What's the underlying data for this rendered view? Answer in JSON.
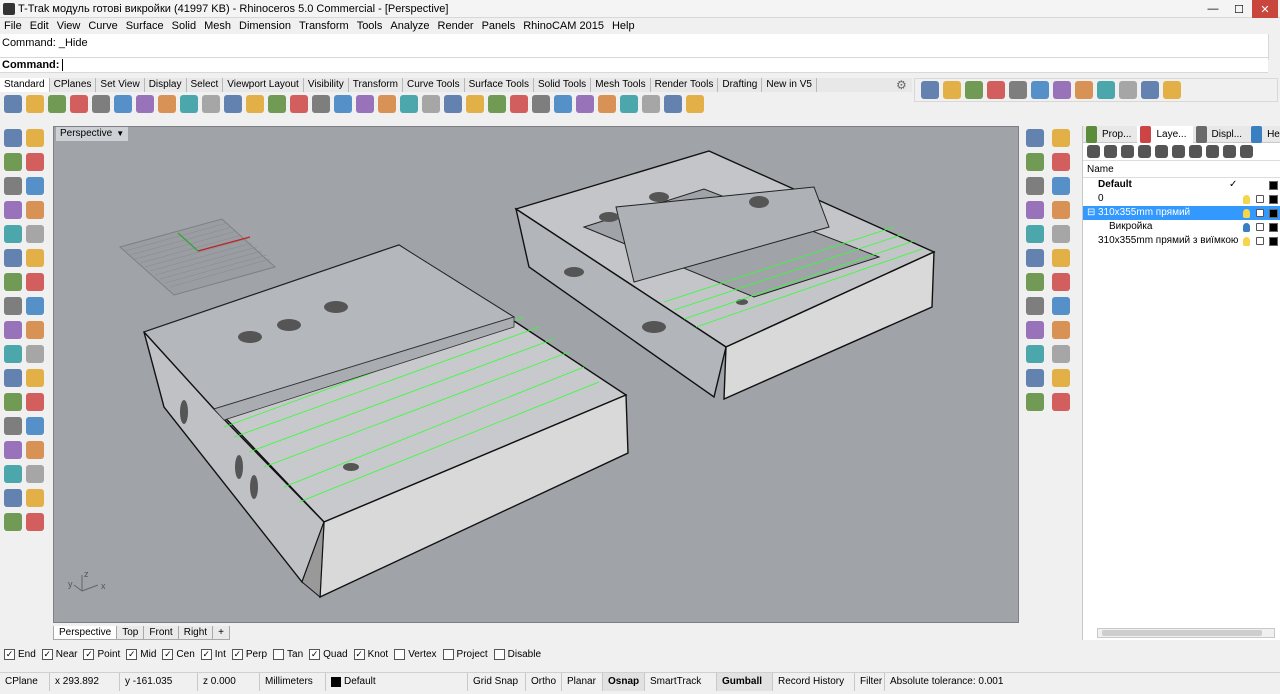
{
  "window": {
    "title": "T-Trak модуль готові викройки (41997 KB) - Rhinoceros 5.0 Commercial - [Perspective]",
    "minimize": "—",
    "maximize": "☐",
    "close": "✕"
  },
  "menu": [
    "File",
    "Edit",
    "View",
    "Curve",
    "Surface",
    "Solid",
    "Mesh",
    "Dimension",
    "Transform",
    "Tools",
    "Analyze",
    "Render",
    "Panels",
    "RhinoCAM 2015",
    "Help"
  ],
  "command": {
    "history": "Command: _Hide",
    "prompt": "Command:"
  },
  "toolbar_tabs": [
    "Standard",
    "CPlanes",
    "Set View",
    "Display",
    "Select",
    "Viewport Layout",
    "Visibility",
    "Transform",
    "Curve Tools",
    "Surface Tools",
    "Solid Tools",
    "Mesh Tools",
    "Render Tools",
    "Drafting",
    "New in V5"
  ],
  "toolbar_icons": [
    "new-icon",
    "open-icon",
    "save-icon",
    "print-icon",
    "import-icon",
    "cut-icon",
    "copy-icon",
    "paste-icon",
    "undo-icon",
    "hand-pan-icon",
    "rotate-view-icon",
    "zoom-icon",
    "zoom-window-icon",
    "zoom-extents-icon",
    "zoom-selected-icon",
    "viewport-4-icon",
    "grid-icon",
    "car-icon",
    "move-icon",
    "properties-icon",
    "light-bulb-icon",
    "layer-icon",
    "render-color-icon",
    "color-wheel-icon",
    "wire-sphere-icon",
    "shaded-sphere-icon",
    "render-sphere-icon",
    "ghost-sphere-icon",
    "blue-sphere-icon",
    "pencil-icon",
    "options-icon",
    "help-icon"
  ],
  "right_toolbar_icons": [
    "points-icon",
    "control-points-icon",
    "edit-points-icon",
    "drag-handle-icon",
    "box-icon",
    "rotate-icon",
    "gumball-icon",
    "move-icon",
    "mirror-icon",
    "cage-icon",
    "scale-icon",
    "more-icon"
  ],
  "left_tool_icons": [
    "select-arrow-icon",
    "point-icon",
    "polyline-icon",
    "rectangle-icon",
    "circle-icon",
    "ellipse-icon",
    "arc-icon",
    "polygon-icon",
    "curve-icon",
    "free-curve-icon",
    "surface-icon",
    "extrude-icon",
    "box-icon",
    "sphere-icon",
    "cylinder-icon",
    "loft-icon",
    "boolean-icon",
    "explode-icon",
    "fillet-icon",
    "chamfer-icon",
    "offset-icon",
    "trim-icon",
    "split-icon",
    "join-icon",
    "dimension-icon",
    "text-icon",
    "gumball-icon",
    "array-icon",
    "grid-array-icon",
    "mirror-icon",
    "check-icon",
    "mesh-icon",
    "analyze-icon",
    "render-icon"
  ],
  "mid_tool_icons": [
    "properties-icon",
    "flame-icon",
    "surface-blue-icon",
    "plane-icon",
    "cube-blue-icon",
    "cube-icon",
    "surface-edit-icon",
    "edge-icon",
    "shell-icon",
    "network-icon",
    "rebuild-icon",
    "paint-icon",
    "boolean-blue-icon",
    "sphere-blue-icon",
    "match-icon",
    "blend-icon",
    "unroll-icon",
    "cap-icon",
    "ruler-icon",
    "dimension-red-icon",
    "grip-icon",
    "clipping-plane-icon",
    "section-icon",
    "camera-icon"
  ],
  "viewport": {
    "label": "Perspective",
    "axis_x": "x",
    "axis_y": "y",
    "axis_z": "z"
  },
  "viewport_tabs": [
    "Perspective",
    "Top",
    "Front",
    "Right",
    "+"
  ],
  "panel": {
    "tabs": [
      {
        "label": "Prop...",
        "icon": "color-wheel-icon"
      },
      {
        "label": "Laye...",
        "icon": "layer-icon"
      },
      {
        "label": "Displ...",
        "icon": "display-icon"
      },
      {
        "label": "Help",
        "icon": "help-icon"
      }
    ],
    "tool_icons": [
      "new-layer-icon",
      "new-sublayer-icon",
      "delete-icon",
      "move-up-icon",
      "move-down-icon",
      "move-to-parent-icon",
      "filter-icon",
      "select-objects-icon",
      "layer-tools-icon",
      "layer-help-icon"
    ],
    "header": "Name",
    "layers": [
      {
        "name": "Default",
        "bold": true,
        "current": true,
        "check": "✓",
        "selected": false,
        "indent": 1
      },
      {
        "name": "0",
        "bold": false,
        "current": false,
        "check": "",
        "selected": false,
        "indent": 1
      },
      {
        "name": "310x355mm прямий",
        "bold": false,
        "current": false,
        "check": "",
        "selected": true,
        "indent": 1,
        "toggle": "⊟"
      },
      {
        "name": "Викройка",
        "bold": false,
        "current": false,
        "check": "",
        "selected": false,
        "indent": 2
      },
      {
        "name": "310x355mm прямий з виїмкою",
        "bold": false,
        "current": false,
        "check": "",
        "selected": false,
        "indent": 1
      }
    ]
  },
  "osnaps": [
    {
      "label": "End",
      "checked": true
    },
    {
      "label": "Near",
      "checked": true
    },
    {
      "label": "Point",
      "checked": true
    },
    {
      "label": "Mid",
      "checked": true
    },
    {
      "label": "Cen",
      "checked": true
    },
    {
      "label": "Int",
      "checked": true
    },
    {
      "label": "Perp",
      "checked": true
    },
    {
      "label": "Tan",
      "checked": false
    },
    {
      "label": "Quad",
      "checked": true
    },
    {
      "label": "Knot",
      "checked": true
    },
    {
      "label": "Vertex",
      "checked": false
    },
    {
      "label": "Project",
      "checked": false
    },
    {
      "label": "Disable",
      "checked": false
    }
  ],
  "status": {
    "cplane": "CPlane",
    "x": "x 293.892",
    "y": "y -161.035",
    "z": "z 0.000",
    "units": "Millimeters",
    "layer": "Default",
    "grid_snap": "Grid Snap",
    "ortho": "Ortho",
    "planar": "Planar",
    "osnap": "Osnap",
    "smarttrack": "SmartTrack",
    "gumball": "Gumball",
    "record_history": "Record History",
    "filter": "Filter",
    "tolerance": "Absolute tolerance: 0.001"
  },
  "colors": {
    "viewport_bg": "#a0a3a8",
    "selection": "#3399ff",
    "curve_green": "#33ff33",
    "model_fill": "#d9d9d9"
  }
}
